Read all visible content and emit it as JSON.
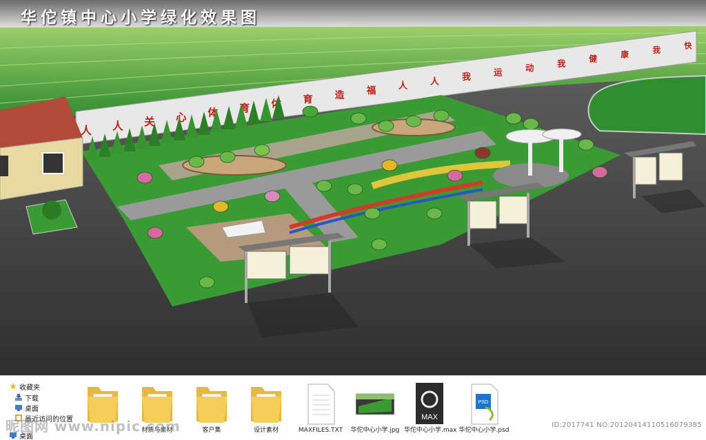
{
  "title": "华佗镇中心小学绿化效果图",
  "wall_slogan": [
    "人",
    "人",
    "关",
    "心",
    "体",
    "育",
    "体",
    "育",
    "造",
    "福",
    "人",
    "人",
    "我",
    "运",
    "动",
    "我",
    "健",
    "康",
    "我",
    "快"
  ],
  "sidebar": {
    "items": [
      {
        "label": "收藏夹",
        "icon": "star-icon"
      },
      {
        "label": "下载",
        "icon": "download-icon"
      },
      {
        "label": "桌面",
        "icon": "desktop-icon"
      },
      {
        "label": "最近访问的位置",
        "icon": "recent-icon"
      },
      {
        "label": "桌面",
        "icon": "desktop-icon"
      }
    ]
  },
  "files": [
    {
      "label": "",
      "type": "folder"
    },
    {
      "label": "材质与素材",
      "type": "folder"
    },
    {
      "label": "客户集",
      "type": "folder"
    },
    {
      "label": "设计素材",
      "type": "folder"
    },
    {
      "label": "MAXFILES.TXT",
      "type": "text"
    },
    {
      "label": "华佗中心小学.jpg",
      "type": "image"
    },
    {
      "label": "华佗中心小学.max",
      "type": "max",
      "badge": "MAX"
    },
    {
      "label": "华佗中心小学.psd",
      "type": "psd",
      "badge": "PSD"
    }
  ],
  "watermark": "昵图网 www.nipic.com",
  "image_id": "ID:2017741 NO:20120414110516079385"
}
